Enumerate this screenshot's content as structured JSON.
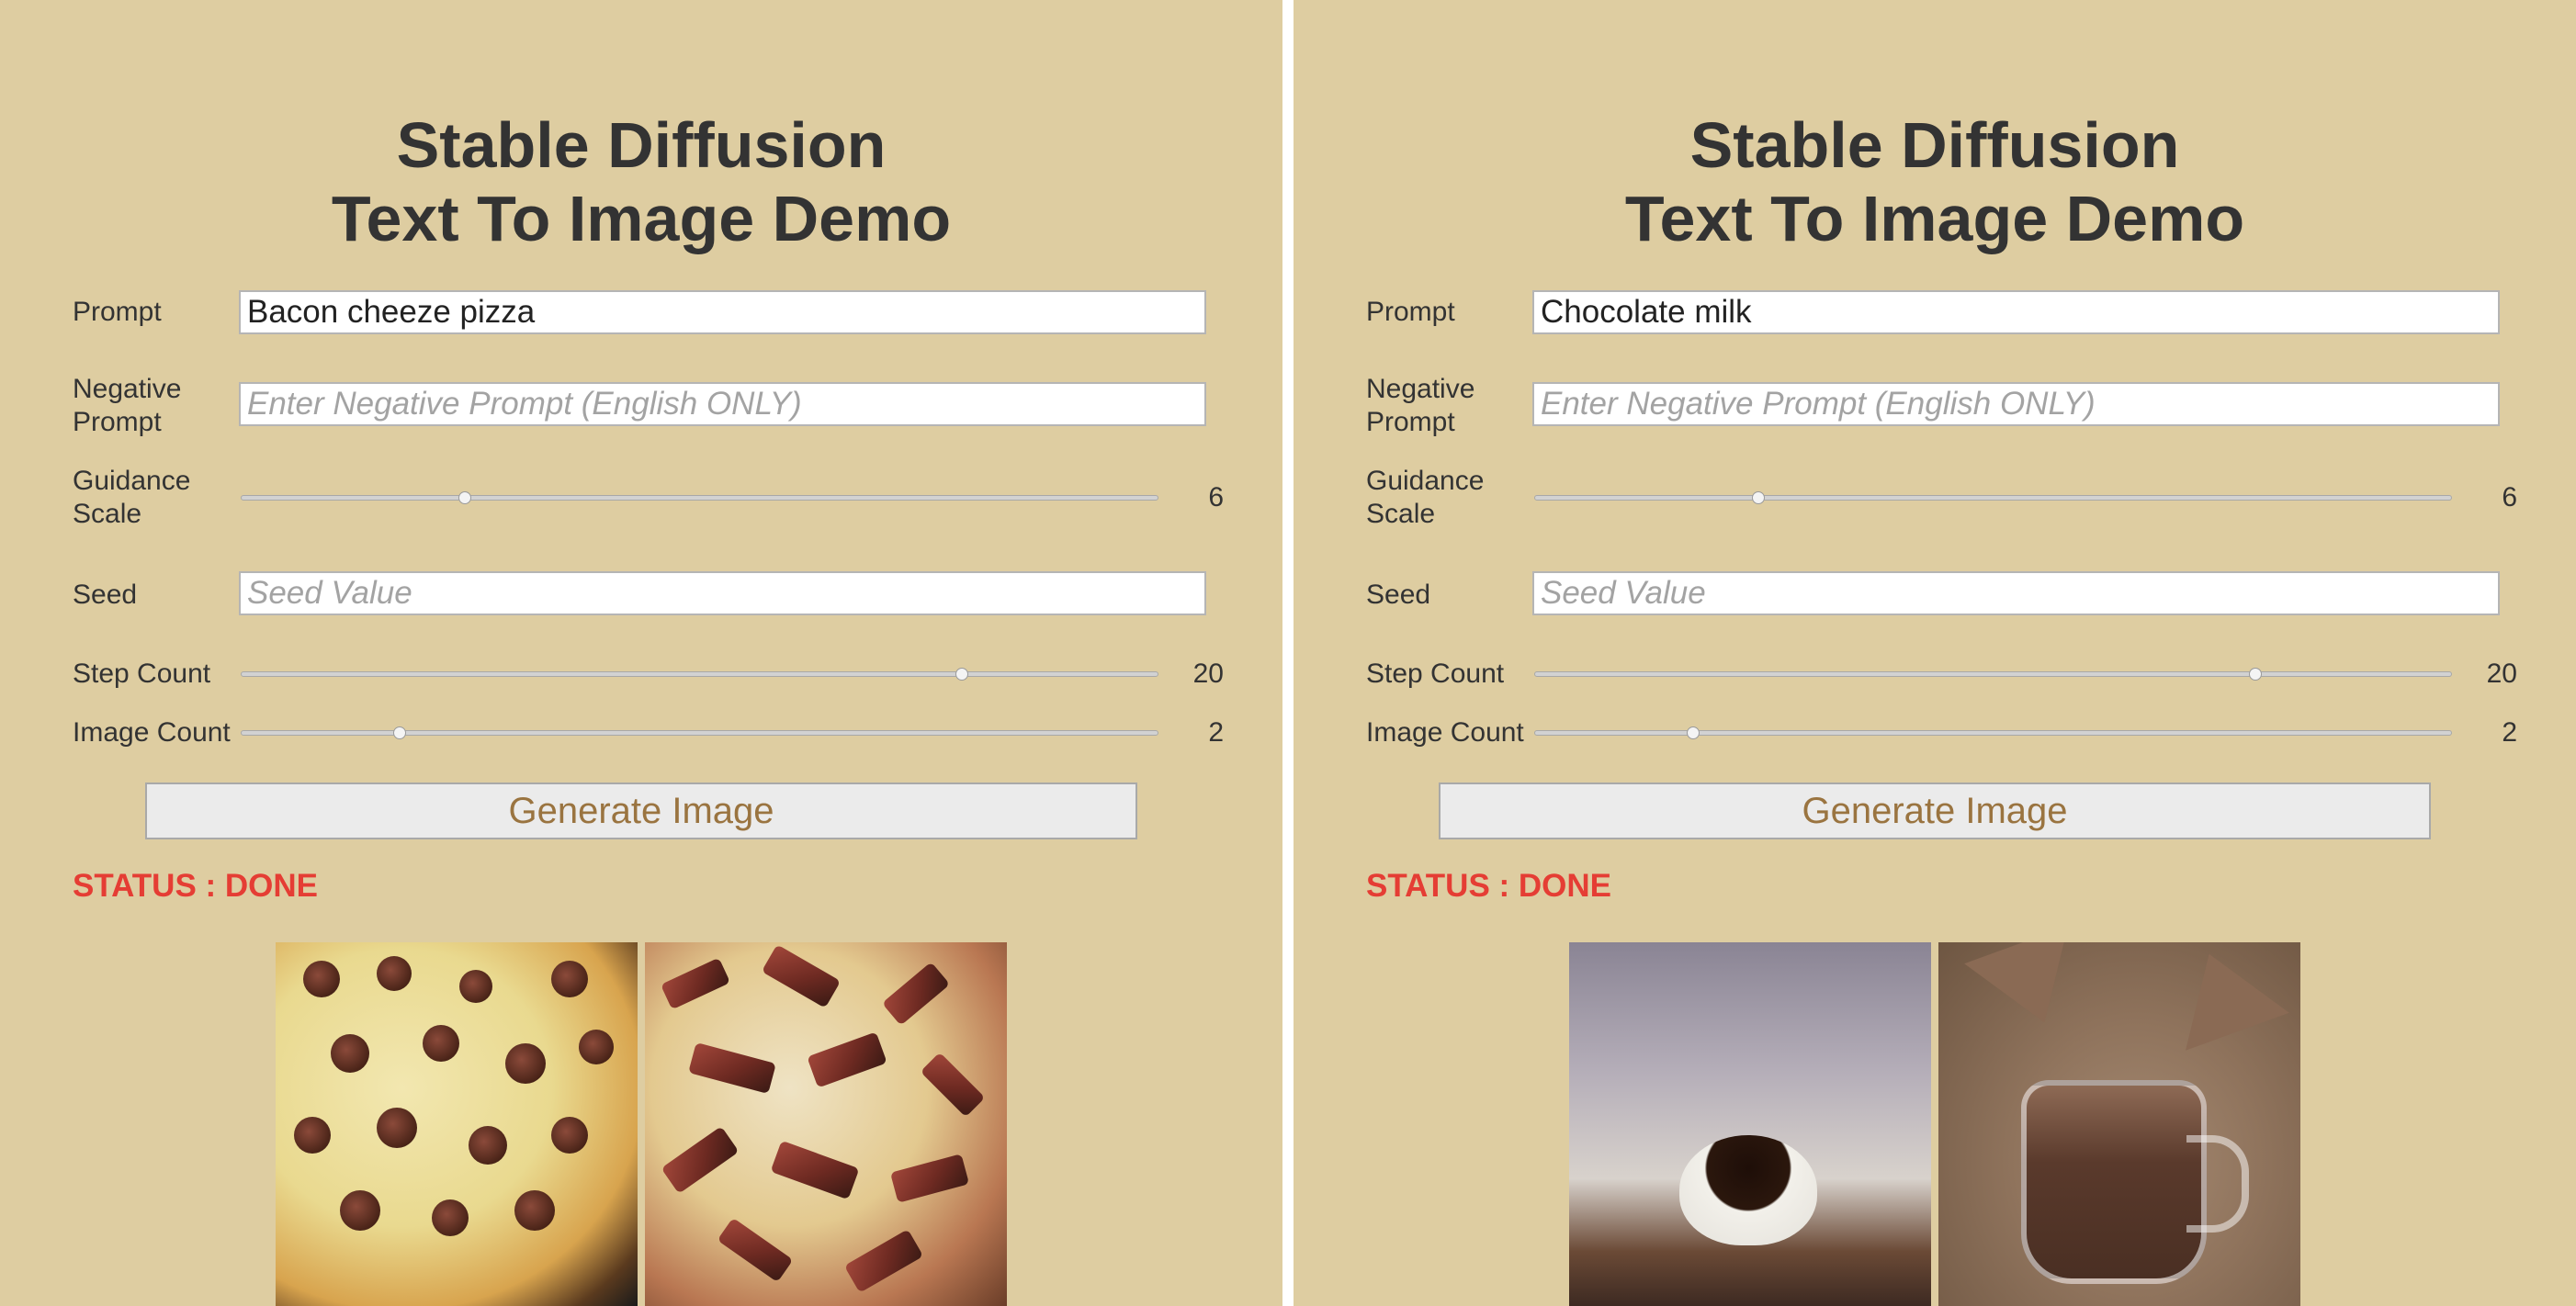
{
  "panels": [
    {
      "title_line1": "Stable Diffusion",
      "title_line2": "Text To Image Demo",
      "prompt_label": "Prompt",
      "prompt_value": "Bacon cheeze pizza",
      "negative_label": "Negative Prompt",
      "negative_placeholder": "Enter Negative Prompt (English ONLY)",
      "guidance_label": "Guidance Scale",
      "guidance_value": "6",
      "seed_label": "Seed",
      "seed_placeholder": "Seed Value",
      "step_label": "Step Count",
      "step_value": "20",
      "image_count_label": "Image Count",
      "image_count_value": "2",
      "generate_label": "Generate Image",
      "status": "STATUS : DONE",
      "images": [
        "pizza-image-1",
        "pizza-image-2"
      ]
    },
    {
      "title_line1": "Stable Diffusion",
      "title_line2": "Text To Image Demo",
      "prompt_label": "Prompt",
      "prompt_value": "Chocolate milk",
      "negative_label": "Negative Prompt",
      "negative_placeholder": "Enter Negative Prompt (English ONLY)",
      "guidance_label": "Guidance Scale",
      "guidance_value": "6",
      "seed_label": "Seed",
      "seed_placeholder": "Seed Value",
      "step_label": "Step Count",
      "step_value": "20",
      "image_count_label": "Image Count",
      "image_count_value": "2",
      "generate_label": "Generate Image",
      "status": "STATUS : DONE",
      "images": [
        "chocolate-poster-image",
        "chocolate-milk-mug-image"
      ]
    }
  ],
  "colors": {
    "background": "#decda1",
    "status": "#e53d34",
    "button_text": "#9a7440"
  }
}
